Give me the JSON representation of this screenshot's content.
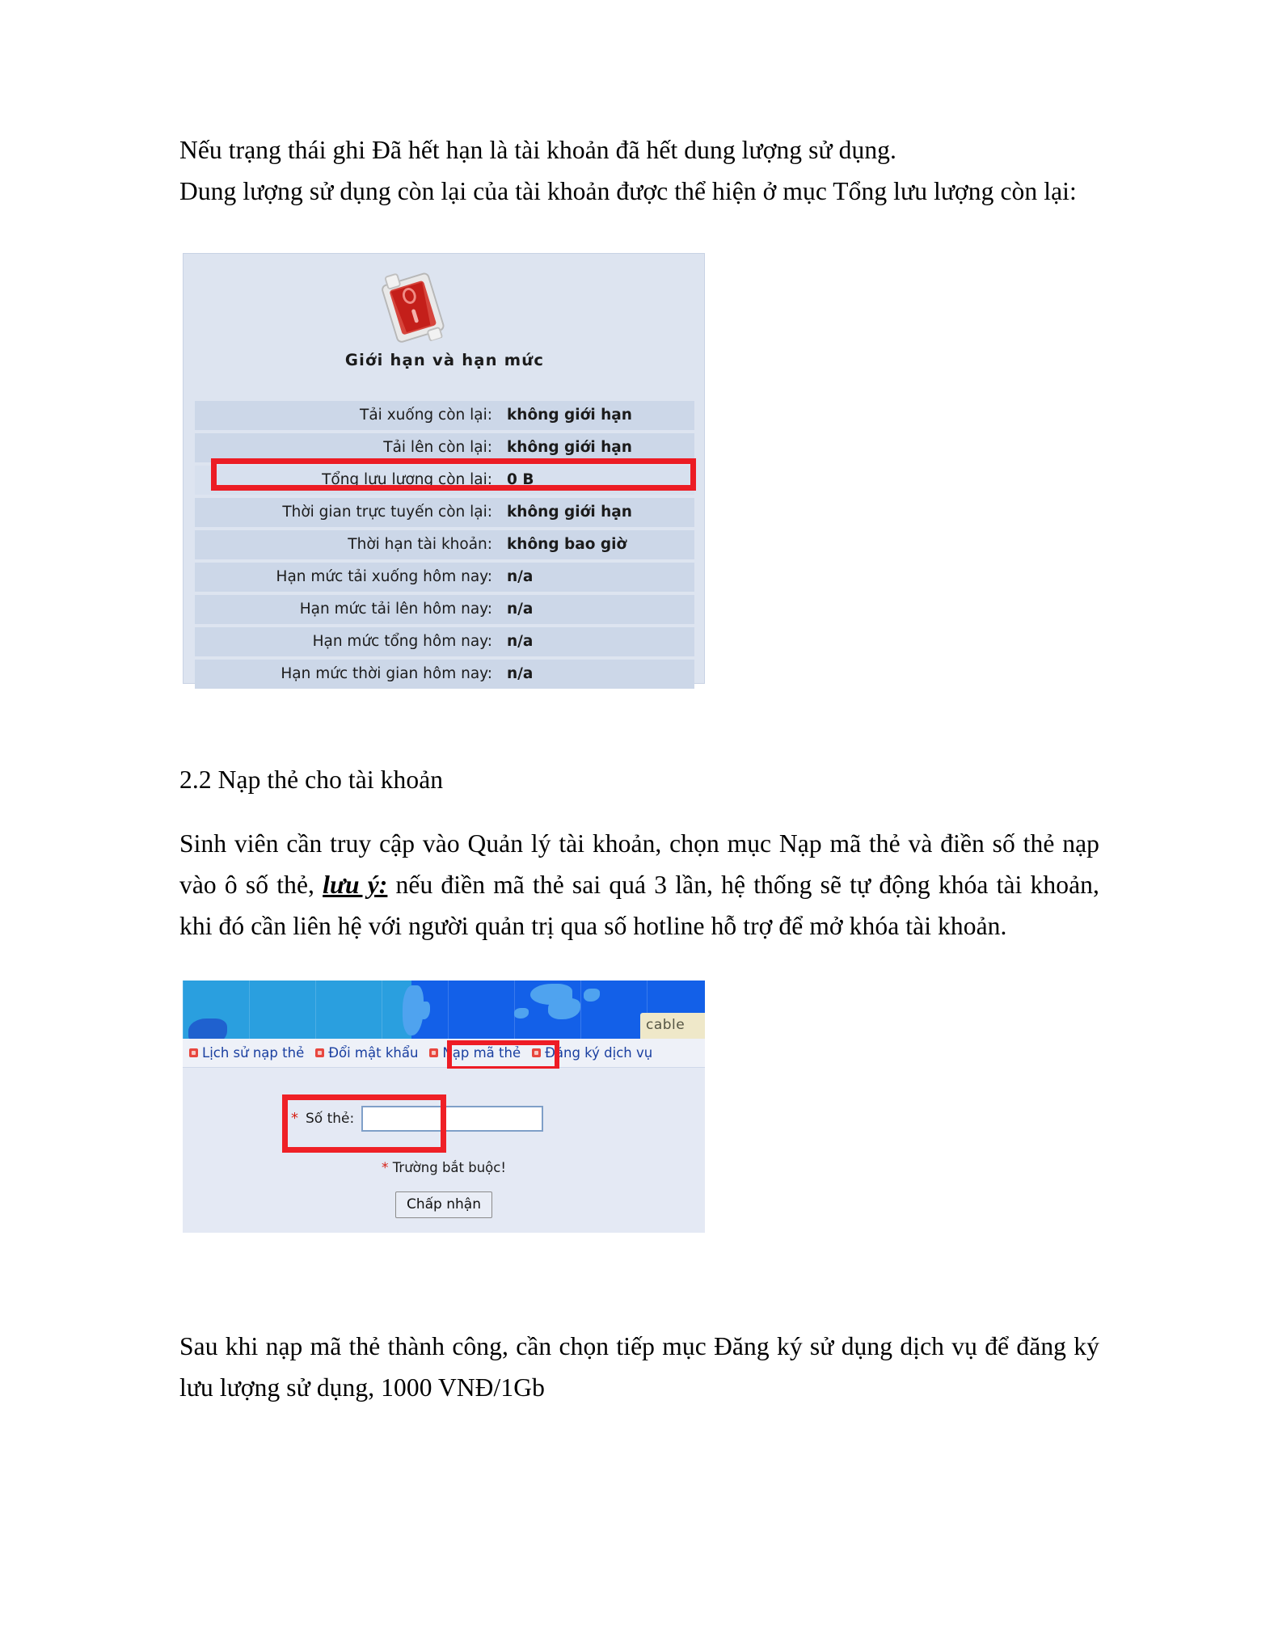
{
  "document": {
    "paragraph_1": {
      "line_1": "Nếu trạng thái ghi Đã hết hạn là tài khoản đã hết dung lượng sử dụng.",
      "line_2": "Dung lượng sử dụng còn lại của tài khoản được thể hiện ở mục Tổng lưu lượng còn lại:"
    },
    "heading_2_2": "2.2 Nạp thẻ cho tài khoản",
    "paragraph_2": {
      "part_1": " Sinh viên cần truy cập vào Quản lý tài khoản, chọn mục Nạp mã thẻ và điền số thẻ nạp vào ô số thẻ, ",
      "emphasis": "lưu ý:",
      "part_2": " nếu điền mã thẻ sai quá 3 lần, hệ thống sẽ tự động khóa tài khoản, khi đó cần liên hệ với người quản trị qua số hotline hỗ trợ để mở khóa tài khoản."
    },
    "paragraph_3": "Sau khi nạp mã thẻ thành công, cần chọn tiếp mục Đăng ký sử dụng dịch vụ để đăng ký lưu lượng sử dụng, 1000 VNĐ/1Gb"
  },
  "figure_limits": {
    "icon": "red-rocker-switch-icon",
    "title": "Giới hạn và hạn mức",
    "rows": [
      {
        "label": "Tải xuống còn lại:",
        "value": "không giới hạn",
        "highlighted": false
      },
      {
        "label": "Tải lên còn lại:",
        "value": "không giới hạn",
        "highlighted": false
      },
      {
        "label": "Tổng lưu lượng còn lại:",
        "value": "0 B",
        "highlighted": true
      },
      {
        "label": "Thời gian trực tuyến còn lại:",
        "value": "không giới hạn",
        "highlighted": false
      },
      {
        "label": "Thời hạn tài khoản:",
        "value": "không bao giờ",
        "highlighted": false
      },
      {
        "label": "Hạn mức tải xuống hôm nay:",
        "value": "n/a",
        "highlighted": false
      },
      {
        "label": "Hạn mức tải lên hôm nay:",
        "value": "n/a",
        "highlighted": false
      },
      {
        "label": "Hạn mức tổng hôm nay:",
        "value": "n/a",
        "highlighted": false
      },
      {
        "label": "Hạn mức thời gian hôm nay:",
        "value": "n/a",
        "highlighted": false
      }
    ],
    "annotation_color": "#ec1c24"
  },
  "figure_recharge": {
    "banner": {
      "logo_text": "cable"
    },
    "nav_items": [
      {
        "label": "Lịch sử nạp thẻ",
        "highlighted": false
      },
      {
        "label": "Đổi mật khẩu",
        "highlighted": false
      },
      {
        "label": "Nạp mã thẻ",
        "highlighted": true
      },
      {
        "label": "Đăng ký dịch vụ",
        "highlighted": false
      }
    ],
    "form": {
      "required_marker": "*",
      "card_label": "Số thẻ:",
      "card_value": "",
      "card_placeholder": "",
      "required_note": "Trường bắt buộc!",
      "submit_label": "Chấp nhận"
    },
    "annotation_color": "#ee1c25"
  }
}
